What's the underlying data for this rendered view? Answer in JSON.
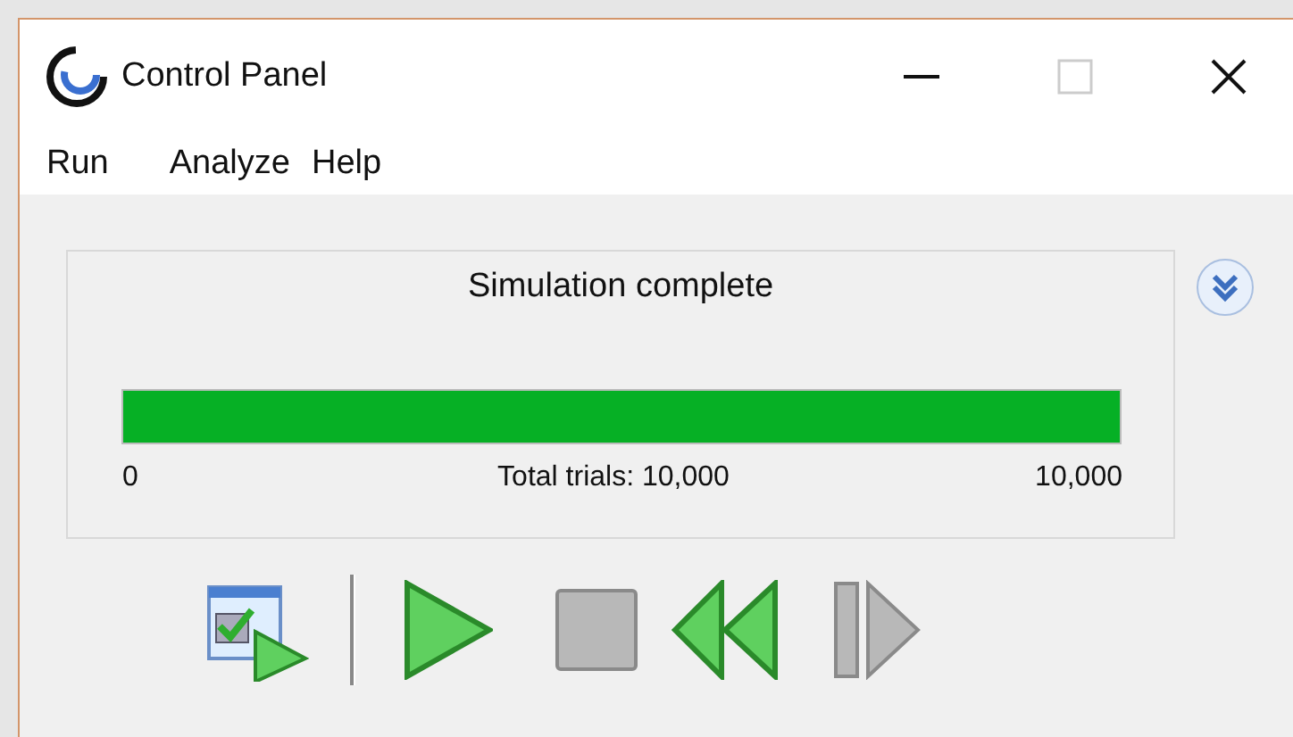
{
  "window": {
    "title": "Control Panel"
  },
  "menu": [
    {
      "label": "Run"
    },
    {
      "label": "Analyze"
    },
    {
      "label": "Help"
    }
  ],
  "status": {
    "title": "Simulation complete",
    "level": 1,
    "min": "0",
    "caption": "Total trials: 10,000",
    "max": "10,000"
  },
  "toolbar": [
    {
      "kind": "results",
      "disabled": false
    },
    {
      "kind": "separator"
    },
    {
      "kind": "run",
      "disabled": false
    },
    {
      "kind": "stop",
      "disabled": true
    },
    {
      "kind": "reset",
      "disabled": false
    },
    {
      "kind": "step",
      "disabled": true
    }
  ]
}
